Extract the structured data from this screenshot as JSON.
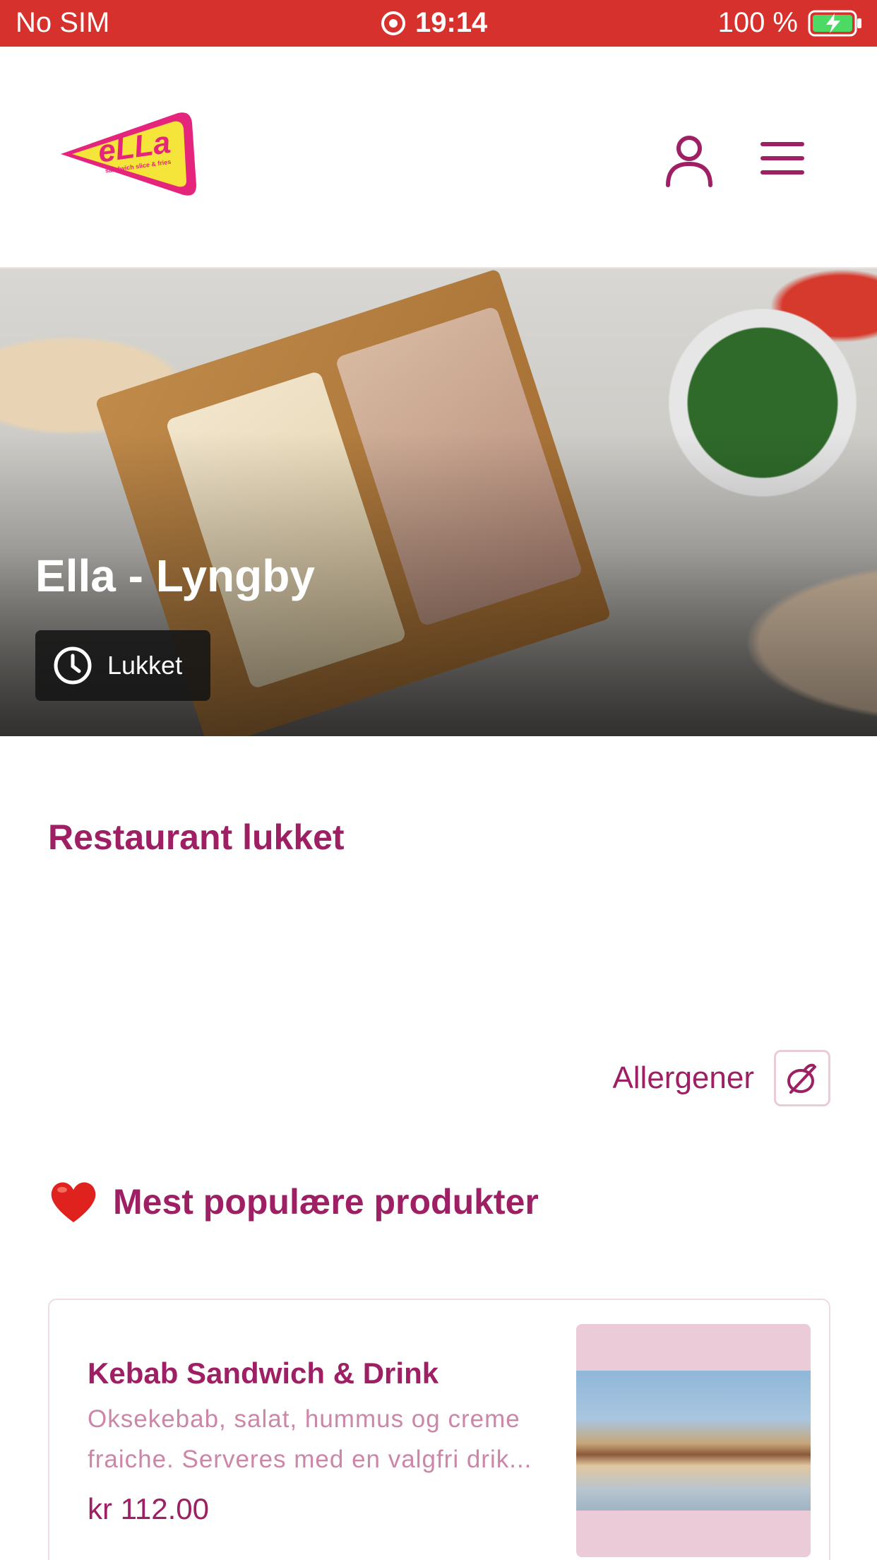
{
  "status_bar": {
    "carrier": "No SIM",
    "time": "19:14",
    "battery": "100 %"
  },
  "header": {
    "logo_text": "eLLa",
    "logo_tagline": "sandwich slice & fries"
  },
  "hero": {
    "restaurant_name": "Ella - Lyngby",
    "status": "Lukket"
  },
  "notice": {
    "title": "Restaurant lukket"
  },
  "allergens": {
    "label": "Allergener"
  },
  "popular": {
    "emoji": "❤️",
    "title": "Mest populære produkter",
    "products": [
      {
        "name": "Kebab Sandwich & Drink",
        "description": "Oksekebab, salat, hummus og creme fraiche. Serveres med en valgfri drik...",
        "price": "kr 112.00"
      }
    ]
  },
  "colors": {
    "status_bar": "#d6312c",
    "brand": "#9e1f63",
    "brand_light": "#cc86a8",
    "logo_yellow": "#f5e43a",
    "logo_pink": "#e5247c"
  }
}
